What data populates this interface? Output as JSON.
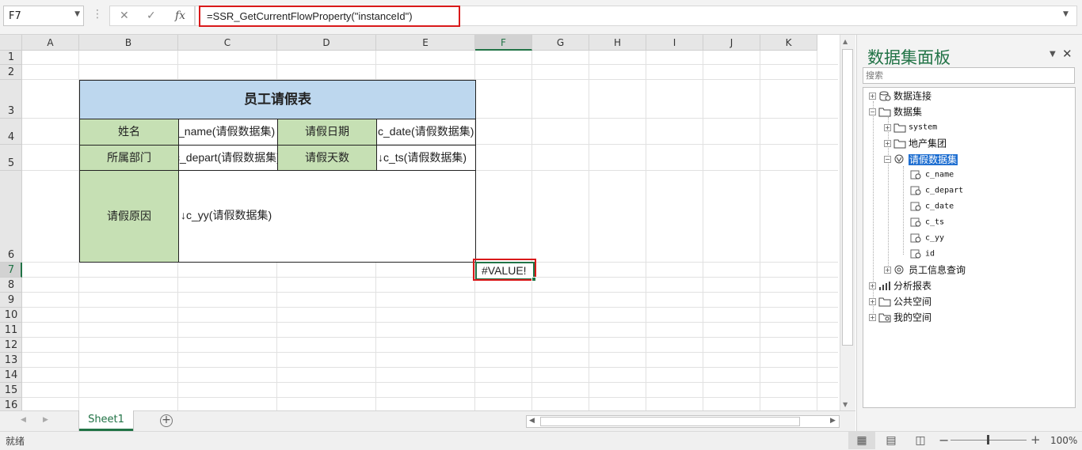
{
  "formula_bar": {
    "name_box": "F7",
    "cancel_icon": "close-icon",
    "enter_icon": "check-icon",
    "fx_label": "fx",
    "formula": "=SSR_GetCurrentFlowProperty(\"instanceId\")"
  },
  "sheet": {
    "columns": [
      "A",
      "B",
      "C",
      "D",
      "E",
      "F",
      "G",
      "H",
      "I",
      "J",
      "K"
    ],
    "selected_column": "F",
    "rows": [
      "1",
      "2",
      "3",
      "4",
      "5",
      "6",
      "7",
      "8",
      "9",
      "10",
      "11",
      "12",
      "13",
      "14",
      "15",
      "16"
    ],
    "selected_row": "7",
    "form": {
      "title": "员工请假表",
      "name_label": "姓名",
      "name_value": "c_name(请假数据集)",
      "date_label": "请假日期",
      "date_value": "c_date(请假数据集)",
      "depart_label": "所属部门",
      "depart_value": "c_depart(请假数据集)",
      "days_label": "请假天数",
      "days_value": "↓c_ts(请假数据集)",
      "reason_label": "请假原因",
      "reason_value": "↓c_yy(请假数据集)"
    },
    "active_cell_value": "#VALUE!"
  },
  "tabs": {
    "sheet1": "Sheet1",
    "add_icon": "plus-circle-icon"
  },
  "status": {
    "ready": "就绪",
    "zoom": "100%",
    "zoom_minus": "−",
    "zoom_plus": "+"
  },
  "panel": {
    "title": "数据集面板",
    "search_placeholder": "搜索",
    "tree": {
      "connections": "数据连接",
      "datasets": "数据集",
      "system": "system",
      "group": "地产集团",
      "leave_dataset": "请假数据集",
      "fields": [
        "c_name",
        "c_depart",
        "c_date",
        "c_ts",
        "c_yy",
        "id"
      ],
      "employee_query": "员工信息查询",
      "reports": "分析报表",
      "public_space": "公共空间",
      "my_space": "我的空间"
    }
  },
  "colors": {
    "accent": "#217346",
    "highlight_red": "#d9191a",
    "title_fill": "#bdd7ee",
    "label_fill": "#c6e0b4",
    "tree_selection": "#1f6fd1"
  }
}
